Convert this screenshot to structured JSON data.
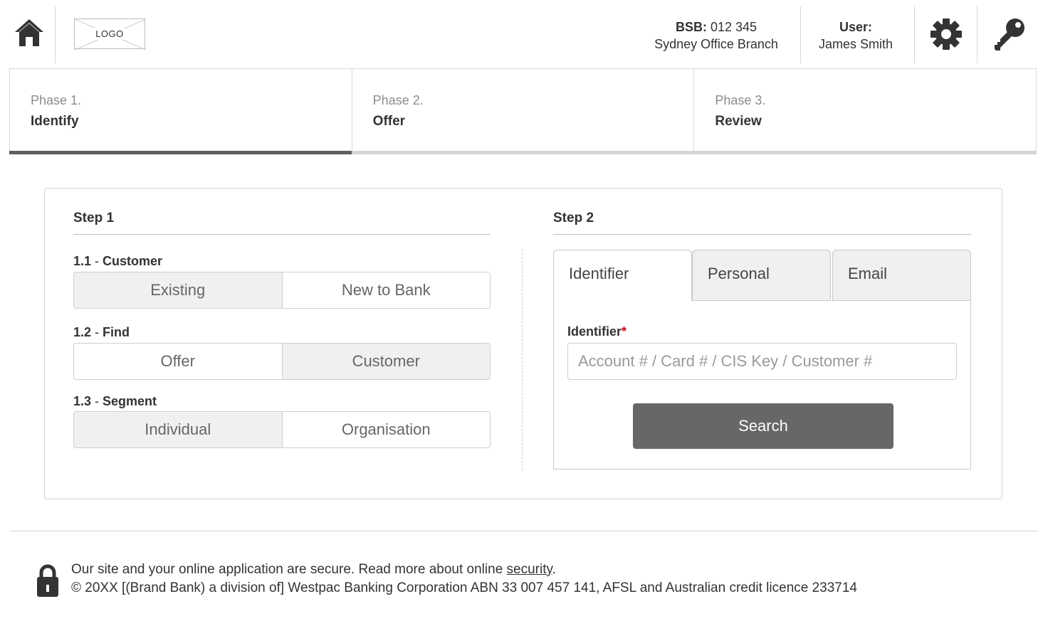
{
  "header": {
    "logo_text": "LOGO",
    "bsb_label": "BSB:",
    "bsb_value": "012 345",
    "branch": "Sydney Office Branch",
    "user_label": "User:",
    "user_name": "James Smith",
    "icons": [
      "home-icon",
      "gear-icon",
      "key-icon"
    ]
  },
  "phases": [
    {
      "num": "Phase 1.",
      "name": "Identify",
      "active": true
    },
    {
      "num": "Phase 2.",
      "name": "Offer",
      "active": false
    },
    {
      "num": "Phase 3.",
      "name": "Review",
      "active": false
    }
  ],
  "step1": {
    "title": "Step 1",
    "groups": [
      {
        "num": "1.1",
        "label": "Customer",
        "options": [
          "Existing",
          "New to Bank"
        ],
        "selected": "Existing"
      },
      {
        "num": "1.2",
        "label": "Find",
        "options": [
          "Offer",
          "Customer"
        ],
        "selected": "Customer"
      },
      {
        "num": "1.3",
        "label": "Segment",
        "options": [
          "Individual",
          "Organisation"
        ],
        "selected": "Individual"
      }
    ]
  },
  "step2": {
    "title": "Step 2",
    "tabs": [
      "Identifier",
      "Personal",
      "Email"
    ],
    "active_tab": "Identifier",
    "field_label": "Identifier",
    "field_required_mark": "*",
    "field_value": "",
    "field_placeholder": "Account # / Card # / CIS Key / Customer #",
    "search_label": "Search"
  },
  "footer": {
    "secure_text": "Our site and your online application are secure. Read more about online ",
    "security_link": "security",
    "secure_end": ".",
    "copyright": "© 20XX [(Brand Bank) a division of] Westpac Banking Corporation ABN 33 007 457 141, AFSL and Australian credit licence 233714"
  },
  "colors": {
    "active_phase_bar": "#5f5f5f",
    "inactive_phase_bar": "#d4d4d4",
    "search_button": "#676767",
    "required": "#d0021b"
  }
}
